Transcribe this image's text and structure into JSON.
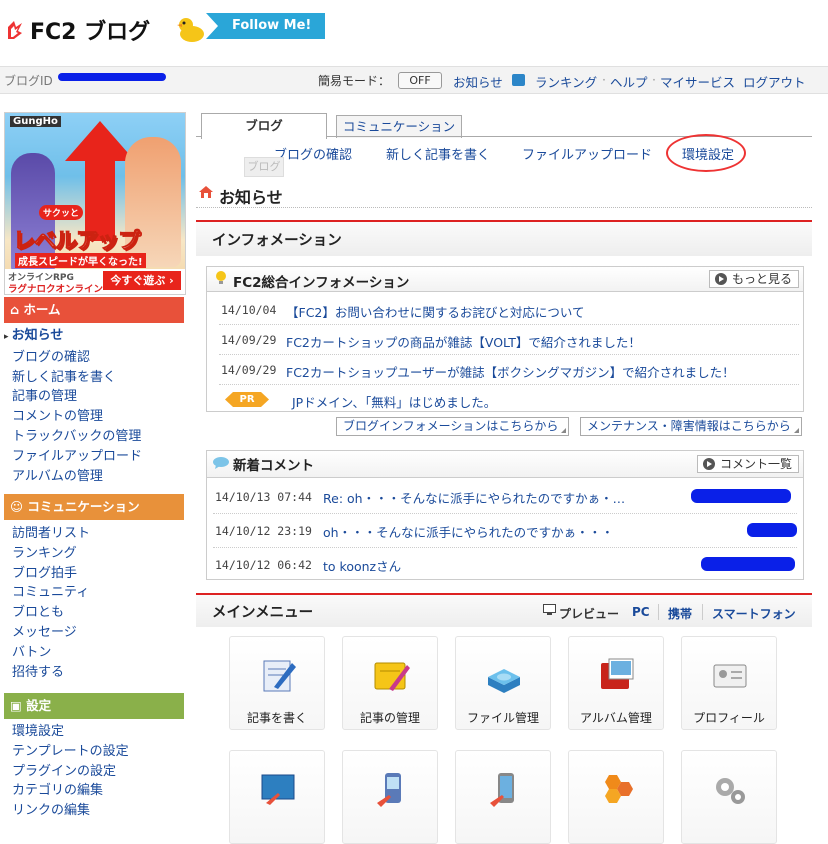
{
  "header": {
    "logo_text": "FC2 ブログ",
    "follow_label": "Follow Me!"
  },
  "userbar": {
    "blog_id_label": "ブログID",
    "mode_label": "簡易モード：",
    "mode_value": "OFF",
    "links": [
      "お知らせ",
      "ランキング",
      "ヘルプ",
      "マイサービス",
      "ログアウト"
    ]
  },
  "ad": {
    "brand": "GungHo",
    "bubble": "サクッと",
    "headline": "レベルアップ",
    "sub": "成長スピードが早くなった!",
    "footer1": "オンラインRPG",
    "footer2": "ラグナロクオンライン",
    "cta": "今すぐ遊ぶ"
  },
  "sidebar": {
    "home": {
      "title": "ホーム",
      "items": [
        "お知らせ",
        "ブログの確認",
        "新しく記事を書く",
        "記事の管理",
        "コメントの管理",
        "トラックバックの管理",
        "ファイルアップロード",
        "アルバムの管理"
      ]
    },
    "community": {
      "title": "コミュニケーション",
      "items": [
        "訪問者リスト",
        "ランキング",
        "ブログ拍手",
        "コミュニティ",
        "ブロとも",
        "メッセージ",
        "バトン",
        "招待する"
      ]
    },
    "settings": {
      "title": "設定",
      "items": [
        "環境設定",
        "テンプレートの設定",
        "プラグインの設定",
        "カテゴリの編集",
        "リンクの編集"
      ]
    }
  },
  "tabs": [
    "ブログ",
    "コミュニケーション"
  ],
  "subnav": [
    "ブログの確認",
    "新しく記事を書く",
    "ファイルアップロード",
    "環境設定"
  ],
  "ghost_tooltip": "ブログ",
  "notice_title": "お知らせ",
  "information": {
    "section_title": "インフォメーション",
    "box_title": "FC2総合インフォメーション",
    "more_label": "もっと見る",
    "news": [
      {
        "date": "14/10/04",
        "text": "【FC2】お問い合わせに関するお詫びと対応について"
      },
      {
        "date": "14/09/29",
        "text": "FC2カートショップの商品が雑誌【VOLT】で紹介されました！"
      },
      {
        "date": "14/09/29",
        "text": "FC2カートショップユーザーが雑誌【ボクシングマガジン】で紹介されました！"
      }
    ],
    "pr_label": "PR",
    "pr_text": "JPドメイン、「無料」はじめました。",
    "link_blog_info": "ブログインフォメーションはこちらから",
    "link_maintenance": "メンテナンス・障害情報はこちらから"
  },
  "comments": {
    "box_title": "新着コメント",
    "list_label": "コメント一覧",
    "rows": [
      {
        "date": "14/10/13 07:44",
        "text": "Re: oh・・・そんなに派手にやられたのですかぁ・…"
      },
      {
        "date": "14/10/12 23:19",
        "text": "oh・・・そんなに派手にやられたのですかぁ・・・"
      },
      {
        "date": "14/10/12 06:42",
        "text": "to koonzさん"
      }
    ]
  },
  "main_menu": {
    "title": "メインメニュー",
    "preview_label": "プレビュー",
    "preview_links": [
      "PC",
      "携帯",
      "スマートフォン"
    ],
    "tiles": [
      "記事を書く",
      "記事の管理",
      "ファイル管理",
      "アルバム管理",
      "プロフィール"
    ]
  },
  "colors": {
    "accent_red": "#d22222",
    "home_header": "#e8513a",
    "community_header": "#e8913a",
    "settings_header": "#8ab04a",
    "link_blue": "#1a4a9a",
    "redaction": "#0a20e8"
  }
}
